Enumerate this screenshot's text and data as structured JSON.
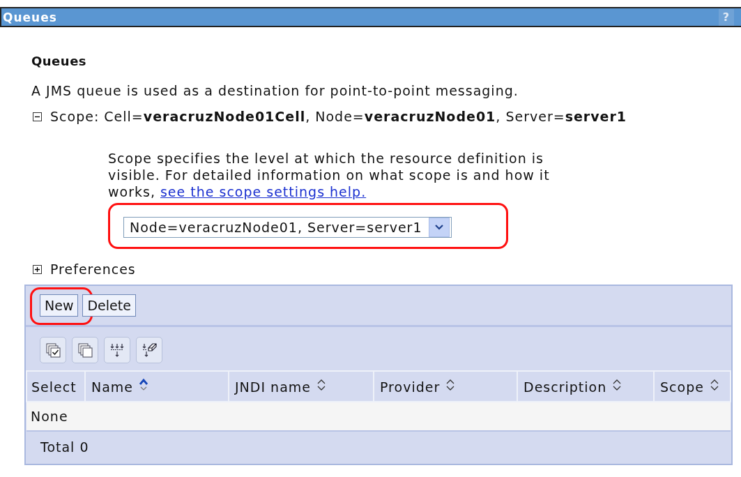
{
  "window": {
    "title": "Queues",
    "help": "?"
  },
  "heading": "Queues",
  "description": "A JMS queue is used as a destination for point-to-point messaging.",
  "scope": {
    "expanded": true,
    "text": "Scope: Cell=**veracruzNode01Cell**, Node=**veracruzNode01**, Server=**server1**",
    "help_text": "Scope specifies the level at which the resource definition is visible. For detailed information on what scope is and how it works,",
    "help_link": "see the scope settings help.",
    "value": "Node=veracruzNode01, Server=server1",
    "highlighted": true
  },
  "preferences": {
    "expanded": false,
    "label": "Preferences"
  },
  "buttons": [
    {
      "label": "New",
      "highlighted": true
    },
    {
      "label": "Delete",
      "highlighted": false
    }
  ],
  "tools": [
    {
      "kind": "select-all"
    },
    {
      "kind": "deselect-all"
    },
    {
      "kind": "filter"
    },
    {
      "kind": "clear-filter"
    }
  ],
  "table": {
    "columns": [
      {
        "label": "Select",
        "kind": "select"
      },
      {
        "label": "Name",
        "kind": "sortable",
        "sorted": true
      },
      {
        "label": "JNDI name",
        "kind": "sortable",
        "sorted": false
      },
      {
        "label": "Provider",
        "kind": "sortable",
        "sorted": false
      },
      {
        "label": "Description",
        "kind": "sortable",
        "sorted": false
      },
      {
        "label": "Scope",
        "kind": "sortable",
        "sorted": false
      }
    ],
    "empty": "None",
    "total": "Total 0"
  }
}
